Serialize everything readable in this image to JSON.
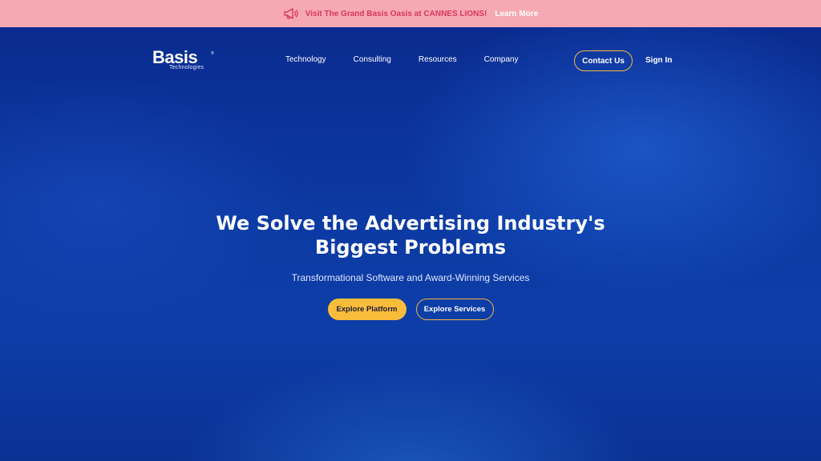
{
  "announcement": {
    "icon": "megaphone-icon",
    "message": "Visit The Grand Basis Oasis at CANNES LIONS!",
    "link_label": "Learn More",
    "bg_color": "#f7a9b3",
    "text_color": "#d6385a"
  },
  "nav": {
    "logo_text": "Basis",
    "logo_reg": "®",
    "logo_sub": "Technologies",
    "items": [
      {
        "label": "Technology"
      },
      {
        "label": "Consulting"
      },
      {
        "label": "Resources"
      },
      {
        "label": "Company"
      }
    ],
    "contact_label": "Contact Us",
    "signin_label": "Sign In"
  },
  "hero": {
    "headline_line1": "We Solve the Advertising Industry's",
    "headline_line2": "Biggest Problems",
    "subheadline": "Transformational Software and Award-Winning Services",
    "primary_cta": "Explore Platform",
    "secondary_cta": "Explore Services",
    "accent_color": "#f9bd3b",
    "bg_color": "#0c3aa3"
  }
}
